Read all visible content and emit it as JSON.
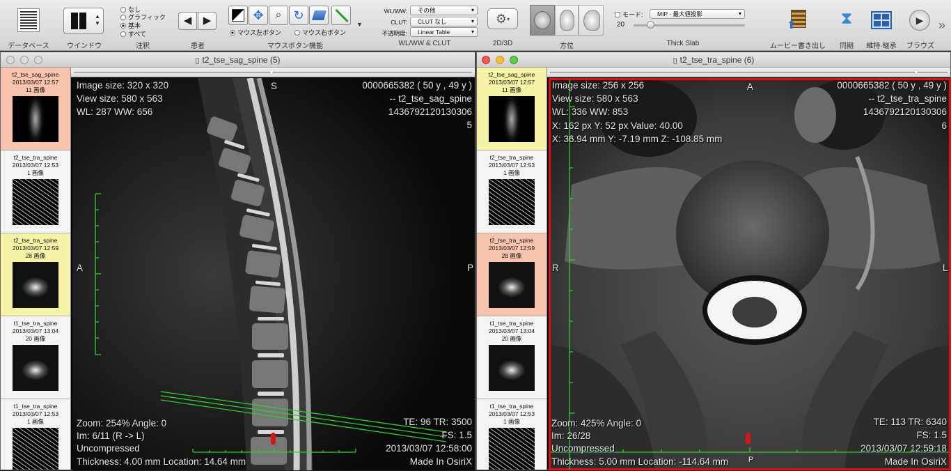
{
  "toolbar": {
    "database_label": "データベース",
    "window_label": "ウインドウ",
    "annotation_label": "注釈",
    "annotation_options": [
      "なし",
      "グラフィック",
      "基本",
      "すべて"
    ],
    "patient_label": "患者",
    "mouse_label": "マウスボタン機能",
    "mouse_left": "マウス左ボタン",
    "mouse_right": "マウス右ボタン",
    "wlww_caption": "WL/WW:",
    "wlww_value": "その他",
    "clut_caption": "CLUT:",
    "clut_value": "CLUT なし",
    "opacity_caption": "不透明度:",
    "opacity_value": "Linear Table",
    "wlww_group_label": "WL/WW & CLUT",
    "twod3d_label": "2D/3D",
    "orientation_label": "方位",
    "mode_caption": "モード:",
    "mode_value": "MIP - 最大値投影",
    "slab_value": "20",
    "thickslab_label": "Thick Slab",
    "movie_label": "ムービー書き出し",
    "sync_label": "同期",
    "tile_label": "維持·継承",
    "browse_label": "ブラウズ",
    "more_glyph": "»"
  },
  "series": [
    {
      "name": "t2_tse_sag_spine",
      "date": "2013/03/07 12:57",
      "count": "11 画像"
    },
    {
      "name": "t2_tse_tra_spine",
      "date": "2013/03/07 12:53",
      "count": "1 画像"
    },
    {
      "name": "t2_tse_tra_spine",
      "date": "2013/03/07 12:59",
      "count": "28 画像"
    },
    {
      "name": "t1_tse_tra_spine",
      "date": "2013/03/07 13:04",
      "count": "20 画像"
    },
    {
      "name": "t1_tse_tra_spine",
      "date": "2013/03/07 12:53",
      "count": "1 画像"
    }
  ],
  "viewer1": {
    "title": "t2_tse_sag_spine (5)",
    "image_size": "Image size: 320 x 320",
    "view_size": "View size: 580 x 563",
    "wl": "WL: 287 WW: 656",
    "patient_id": "0000665382 (  50 y ,  49 y )",
    "series_name": "-- t2_tse_sag_spine",
    "study_id": "1436792120130306",
    "series_no": "5",
    "orient_top": "S",
    "orient_left": "A",
    "orient_right": "P",
    "zoom": "Zoom: 254% Angle: 0",
    "image_no": "Im: 6/11  (R -> L)",
    "compression": "Uncompressed",
    "thickness": "Thickness: 4.00 mm Location: 14.64 mm",
    "te_tr": "TE:  96 TR:  3500",
    "fs": "FS:  1.5",
    "datetime": "2013/03/07 12:58:00",
    "made_in": "Made In OsiriX"
  },
  "viewer2": {
    "title": "t2_tse_tra_spine (6)",
    "image_size": "Image size: 256 x 256",
    "view_size": "View size: 580 x 563",
    "wl": "WL: 336 WW: 853",
    "pixel_value": "X: 162 px Y: 52 px Value: 40.00",
    "mm_coords": "X: 36.94 mm Y: -7.19 mm Z: -108.85 mm",
    "patient_id": "0000665382 (  50 y ,  49 y )",
    "series_name": "-- t2_tse_tra_spine",
    "study_id": "1436792120130306",
    "series_no": "6",
    "orient_top": "A",
    "orient_left": "R",
    "orient_right": "L",
    "orient_bottom": "P",
    "zoom": "Zoom: 425% Angle: 0",
    "image_no": "Im: 26/28",
    "compression": "Uncompressed",
    "thickness": "Thickness: 5.00 mm Location: -114.64 mm",
    "te_tr": "TE:  113 TR:  6340",
    "fs": "FS:  1.5",
    "datetime": "2013/03/07 12:59:18",
    "made_in": "Made In OsiriX"
  },
  "colors": {
    "active_border": "#e01010",
    "thumb_selected": "#f9c4ad",
    "thumb_highlight": "#f6f2a6",
    "ruler": "#33cc33",
    "reference_line": "#33cc33"
  }
}
